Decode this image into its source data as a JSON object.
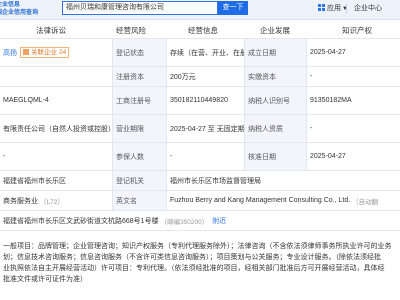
{
  "topbar": {
    "logo_line1": "企业信息",
    "logo_line2": "国企业信用查询",
    "search_value": "福州贝瑞和康管理咨询有限公司",
    "search_button": "查一下",
    "app_label": "应用",
    "user_label": "企业中心"
  },
  "subhead": {
    "legal_rep": "法律诉讼",
    "risk": "经营风险",
    "info": "经营信息",
    "develop": "企业发展",
    "ip": "知识产权"
  },
  "rows": [
    {
      "c1": "高扬",
      "c1_badge": "关联企业",
      "c1_badge_num": "24",
      "c2": "登记状态",
      "c3": "存续（在营、开业、在册）",
      "c4": "成立日期",
      "c5": "2025-04-27"
    },
    {
      "c1": "",
      "c2": "注册资本",
      "c3": "200万元",
      "c4": "实缴资本",
      "c5": "-"
    },
    {
      "c1": "MAEGLQML-4",
      "c2": "工商注册号",
      "c3": "350182110449820",
      "c4": "纳税人识别号",
      "c5": "91350182MA"
    },
    {
      "c1": "有限责任公司（自然人投资或控股）",
      "c2": "营业期限",
      "c3": "2025-04-27 至 无固定期限",
      "c4": "纳税人资质",
      "c5": "-"
    },
    {
      "c1": "-",
      "c2": "参保人数",
      "c3": "-",
      "c4": "核准日期",
      "c5": "2025-04-27"
    },
    {
      "c1": "福建省福州市长乐区",
      "c2": "登记机关",
      "c3": "福州市长乐区市场监督管理局"
    },
    {
      "c1": "商务服务业",
      "c1_extra": "（L72）",
      "c2": "英文名",
      "c3": "Fuzhou Berry and Kang Management Consulting Co., Ltd.",
      "c3_hint": "（自动翻"
    },
    {
      "c1": "福建省福州市长乐区文武砂街道文杭路668号1号楼",
      "c1_hint": "（邮编350200）",
      "c1_extra": "附近"
    }
  ],
  "scope": {
    "line1": "一般项目：品牌管理；企业管理咨询；知识产权服务（专利代理服务除外）；法律咨询（不含依法须律师事务所执业许可的业务",
    "line2": "划；信息技术咨询服务；信息咨询服务（不含许可类信息咨询服务）；项目策划与公关服务；专业设计服务。（除依法须经批",
    "line3": "业执照依法自主开展经营活动）许可项目：专利代理。（依法须经批准的项目，经相关部门批准后方可开展经营活动，具体经",
    "line4": "批准文件或许可证件为准）"
  }
}
